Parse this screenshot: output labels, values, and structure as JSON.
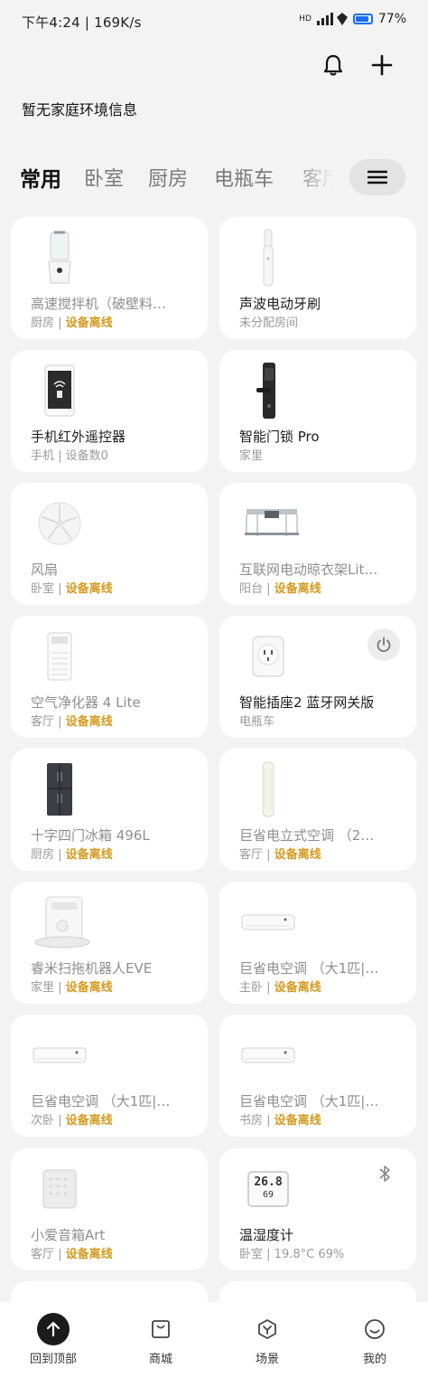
{
  "status": {
    "time_speed": "下午4:24 | 169K/s",
    "network": "HD",
    "battery": "77%"
  },
  "header": {
    "env_info": "暂无家庭环境信息"
  },
  "tabs": [
    "常用",
    "卧室",
    "厨房",
    "电瓶车",
    "客厅"
  ],
  "devices": [
    {
      "name": "高速搅拌机（破壁料…",
      "room": "厨房",
      "status": "设备离线",
      "offline": true,
      "icon": "blender-icon"
    },
    {
      "name": "声波电动牙刷",
      "room": "未分配房间",
      "status": "",
      "offline": false,
      "icon": "toothbrush-icon"
    },
    {
      "name": "手机红外遥控器",
      "room": "手机",
      "status": "设备数0",
      "offline": false,
      "icon": "phone-remote-icon"
    },
    {
      "name": "智能门锁 Pro",
      "room": "家里",
      "status": "",
      "offline": false,
      "icon": "door-lock-icon"
    },
    {
      "name": "风扇",
      "room": "卧室",
      "status": "设备离线",
      "offline": true,
      "icon": "fan-icon"
    },
    {
      "name": "互联网电动晾衣架Lit…",
      "room": "阳台",
      "status": "设备离线",
      "offline": true,
      "icon": "clothes-rack-icon"
    },
    {
      "name": "空气净化器 4 Lite",
      "room": "客厅",
      "status": "设备离线",
      "offline": true,
      "icon": "air-purifier-icon"
    },
    {
      "name": "智能插座2 蓝牙网关版",
      "room": "电瓶车",
      "status": "",
      "offline": false,
      "icon": "smart-plug-icon"
    },
    {
      "name": "十字四门冰箱 496L",
      "room": "厨房",
      "status": "设备离线",
      "offline": true,
      "icon": "fridge-icon"
    },
    {
      "name": "巨省电立式空调 （2…",
      "room": "客厅",
      "status": "设备离线",
      "offline": true,
      "icon": "tower-ac-icon"
    },
    {
      "name": "睿米扫拖机器人EVE",
      "room": "家里",
      "status": "设备离线",
      "offline": true,
      "icon": "robot-vacuum-icon"
    },
    {
      "name": "巨省电空调 （大1匹|…",
      "room": "主卧",
      "status": "设备离线",
      "offline": true,
      "icon": "air-conditioner-icon"
    },
    {
      "name": "巨省电空调 （大1匹|…",
      "room": "次卧",
      "status": "设备离线",
      "offline": true,
      "icon": "air-conditioner-icon"
    },
    {
      "name": "巨省电空调 （大1匹|…",
      "room": "书房",
      "status": "设备离线",
      "offline": true,
      "icon": "air-conditioner-icon"
    },
    {
      "name": "小爱音箱Art",
      "room": "客厅",
      "status": "设备离线",
      "offline": true,
      "icon": "speaker-icon"
    },
    {
      "name": "温湿度计",
      "room": "卧室",
      "status": "19.8°C 69%",
      "offline": false,
      "icon": "thermometer-icon"
    }
  ],
  "thermometer_display": {
    "temp": "26.8",
    "humidity": "69"
  },
  "bottom_nav": [
    {
      "label": "回到顶部",
      "icon": "arrow-up-icon"
    },
    {
      "label": "商城",
      "icon": "shop-icon"
    },
    {
      "label": "场景",
      "icon": "scene-icon"
    },
    {
      "label": "我的",
      "icon": "profile-icon"
    }
  ],
  "colors": {
    "offline": "#d49a1f",
    "background": "#f3f3f3",
    "card": "#ffffff"
  }
}
